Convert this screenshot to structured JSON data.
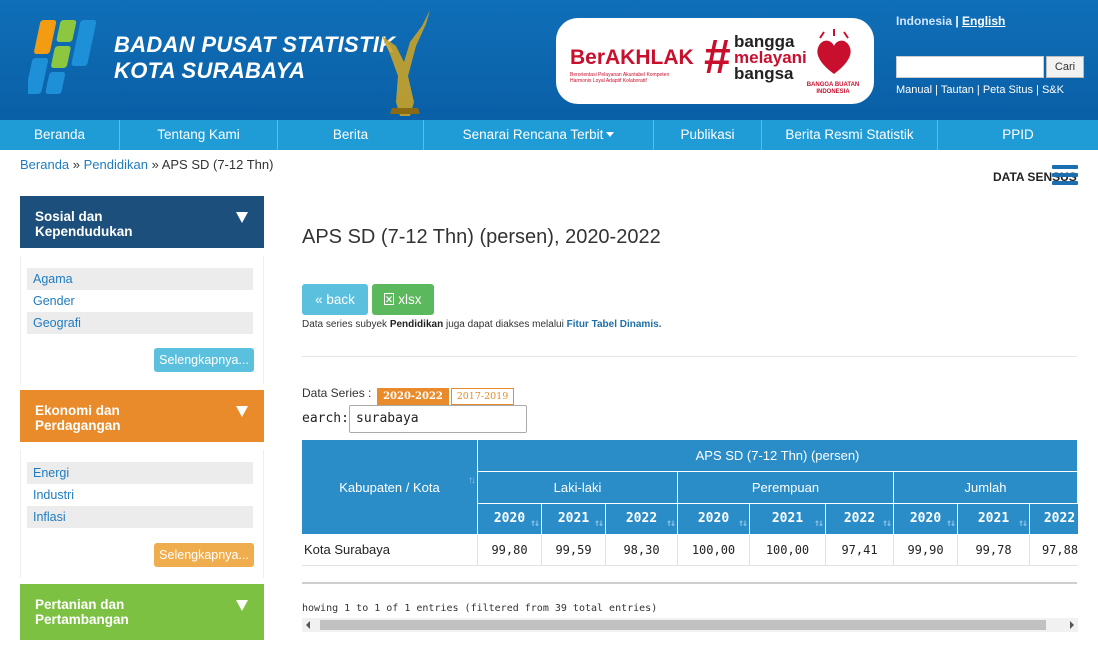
{
  "header": {
    "brand_line1": "BADAN PUSAT STATISTIK",
    "brand_line2": "KOTA SURABAYA",
    "berakhlak": "BerAKHLAK",
    "berakhlak_sub": "Berorientasi Pelayanan Akuntabel Kompeten Harmonis Loyal Adaptif Kolaboratif",
    "bangga": "bangga",
    "melayani": "melayani",
    "bangsa": "bangsa",
    "bangga_buatan": "BANGGA BUATAN INDONESIA",
    "lang_id": "Indonesia",
    "lang_sep": " | ",
    "lang_en": "English",
    "search_button": "Cari",
    "top_links": "Manual | Tautan | Peta Situs | S&K"
  },
  "nav": {
    "items": [
      "Beranda",
      "Tentang Kami",
      "Berita",
      "Senarai Rencana Terbit",
      "Publikasi",
      "Berita Resmi Statistik",
      "PPID"
    ]
  },
  "breadcrumb": {
    "home": "Beranda",
    "sep": " » ",
    "category": "Pendidikan",
    "current": "APS SD (7-12 Thn)"
  },
  "data_sensus": "DATA SENSUS",
  "sidebar": {
    "sections": [
      {
        "title1": "Sosial dan",
        "title2": "Kependudukan",
        "color": "#1d4f7c",
        "items": [
          "Agama",
          "Gender",
          "Geografi"
        ],
        "more": "Selengkapnya...",
        "more_color": "#5bc0de"
      },
      {
        "title1": "Ekonomi dan",
        "title2": "Perdagangan",
        "color": "#e98b2a",
        "items": [
          "Energi",
          "Industri",
          "Inflasi"
        ],
        "more": "Selengkapnya...",
        "more_color": "#f0ad4e"
      },
      {
        "title1": "Pertanian dan",
        "title2": "Pertambangan",
        "color": "#7cc142",
        "items": [],
        "more": "",
        "more_color": ""
      }
    ]
  },
  "main": {
    "title": "APS SD (7-12 Thn) (persen), 2020-2022",
    "back": "« back",
    "xlsx": "xlsx",
    "note_pre": "Data series subyek ",
    "note_bold": "Pendidikan",
    "note_mid": " juga dapat diakses melalui ",
    "note_link": "Fitur Tabel Dinamis.",
    "series_label": "Data Series :",
    "series_active": "2020-2022",
    "series_other": "2017-2019",
    "search_label": "earch:",
    "search_value": "surabaya",
    "info": "howing 1 to 1 of 1 entries (filtered from 39 total entries)"
  },
  "table": {
    "col_region": "Kabupaten / Kota",
    "super_header": "APS SD (7-12 Thn) (persen)",
    "groups": [
      "Laki-laki",
      "Perempuan",
      "Jumlah"
    ],
    "years": [
      "2020",
      "2021",
      "2022",
      "2020",
      "2021",
      "2022",
      "2020",
      "2021",
      "2022"
    ],
    "rows": [
      {
        "region": "Kota Surabaya",
        "values": [
          "99,80",
          "99,59",
          "98,30",
          "100,00",
          "100,00",
          "97,41",
          "99,90",
          "99,78",
          "97,88"
        ]
      }
    ]
  }
}
